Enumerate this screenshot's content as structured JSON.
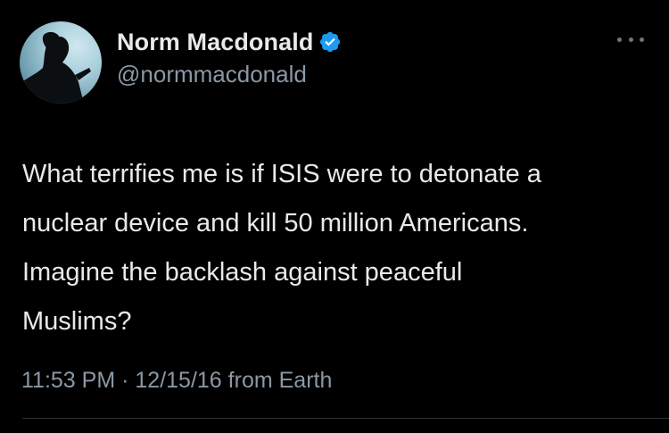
{
  "author": {
    "display_name": "Norm Macdonald",
    "handle": "@normmacdonald",
    "verified_icon": "verified-badge-icon",
    "verified_color": "#1d9bf0"
  },
  "tweet": {
    "lines": [
      "What terrifies me is if ISIS were to detonate a",
      "nuclear device and kill 50 million Americans.",
      "Imagine the backlash against peaceful",
      "Muslims?"
    ]
  },
  "meta": {
    "time": "11:53 PM",
    "separator": "·",
    "date": "12/15/16",
    "source": "from Earth"
  },
  "menu": {
    "icon": "more-options-icon"
  }
}
